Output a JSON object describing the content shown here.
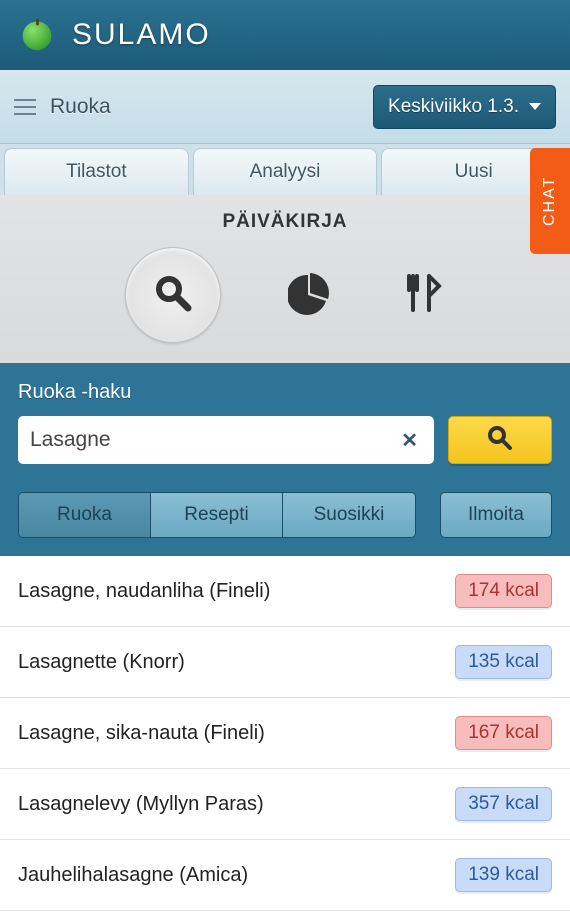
{
  "header": {
    "app_title": "SULAMO"
  },
  "sub_header": {
    "page_label": "Ruoka",
    "date_label": "Keskiviikko 1.3."
  },
  "tabs": {
    "items": [
      {
        "label": "Tilastot"
      },
      {
        "label": "Analyysi"
      },
      {
        "label": "Uusi"
      }
    ]
  },
  "diary": {
    "title": "PÄIVÄKIRJA"
  },
  "search": {
    "label": "Ruoka -haku",
    "query": "Lasagne",
    "filters": {
      "items": [
        {
          "label": "Ruoka",
          "active": true
        },
        {
          "label": "Resepti",
          "active": false
        },
        {
          "label": "Suosikki",
          "active": false
        }
      ],
      "report_label": "Ilmoita"
    }
  },
  "results": {
    "items": [
      {
        "name": "Lasagne, naudanliha (Fineli)",
        "kcal": "174 kcal",
        "color": "red"
      },
      {
        "name": "Lasagnette (Knorr)",
        "kcal": "135 kcal",
        "color": "blue"
      },
      {
        "name": "Lasagne, sika-nauta (Fineli)",
        "kcal": "167 kcal",
        "color": "red"
      },
      {
        "name": "Lasagnelevy (Myllyn Paras)",
        "kcal": "357 kcal",
        "color": "blue"
      },
      {
        "name": "Jauhelihalasagne (Amica)",
        "kcal": "139 kcal",
        "color": "blue"
      }
    ]
  },
  "chat": {
    "label": "CHAT"
  }
}
